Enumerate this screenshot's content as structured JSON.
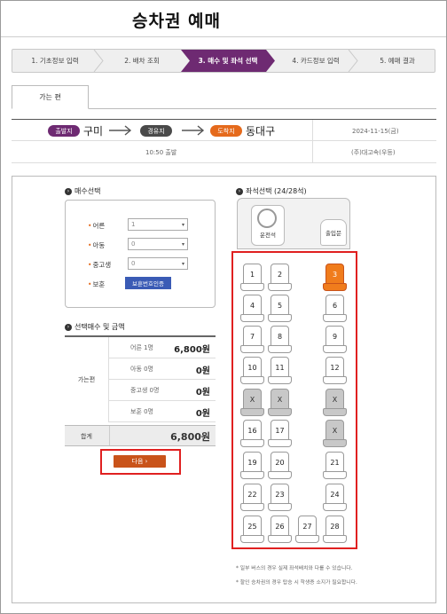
{
  "page": {
    "title": "승차권 예매"
  },
  "steps": [
    {
      "label": "1. 기초정보 입력"
    },
    {
      "label": "2. 배차 조회"
    },
    {
      "label": "3. 매수 및 좌석 선택"
    },
    {
      "label": "4. 카드정보 입력"
    },
    {
      "label": "5. 예매 결과"
    }
  ],
  "tab": {
    "label": "가는 편"
  },
  "route": {
    "dep_badge": "출발지",
    "dep_place": "구미",
    "via_badge": "경유지",
    "arr_badge": "도착지",
    "arr_place": "동대구",
    "date": "2024-11-15(금)",
    "dep_time": "10:50 출발",
    "company": "(주)대고속(우등)"
  },
  "count": {
    "heading": "매수선택",
    "rows": [
      {
        "label": "어른",
        "value": "1"
      },
      {
        "label": "아동",
        "value": "0"
      },
      {
        "label": "중고생",
        "value": "0"
      },
      {
        "label": "보훈",
        "button": "보훈번호인증"
      }
    ]
  },
  "price": {
    "heading": "선택매수 및 금액",
    "group_label": "가는편",
    "rows": [
      {
        "label": "어른 1명",
        "value": "6,800원"
      },
      {
        "label": "아동 0명",
        "value": "0원"
      },
      {
        "label": "중고생 0명",
        "value": "0원"
      },
      {
        "label": "보훈 0명",
        "value": "0원"
      }
    ],
    "total_label": "합계",
    "total_value": "6,800원"
  },
  "next_button": "다음",
  "seat": {
    "heading": "좌석선택 (24/28석)",
    "driver_label": "운전석",
    "door_label": "출입문",
    "seats": [
      {
        "n": "1",
        "state": "open"
      },
      {
        "n": "2",
        "state": "open"
      },
      {
        "n": "3",
        "state": "selected"
      },
      {
        "n": "4",
        "state": "open"
      },
      {
        "n": "5",
        "state": "open"
      },
      {
        "n": "6",
        "state": "open"
      },
      {
        "n": "7",
        "state": "open"
      },
      {
        "n": "8",
        "state": "open"
      },
      {
        "n": "9",
        "state": "open"
      },
      {
        "n": "10",
        "state": "open"
      },
      {
        "n": "11",
        "state": "open"
      },
      {
        "n": "12",
        "state": "open"
      },
      {
        "n": "X",
        "state": "taken"
      },
      {
        "n": "X",
        "state": "taken"
      },
      {
        "n": "X",
        "state": "taken"
      },
      {
        "n": "16",
        "state": "open"
      },
      {
        "n": "17",
        "state": "open"
      },
      {
        "n": "X",
        "state": "taken"
      },
      {
        "n": "19",
        "state": "open"
      },
      {
        "n": "20",
        "state": "open"
      },
      {
        "n": "21",
        "state": "open"
      },
      {
        "n": "22",
        "state": "open"
      },
      {
        "n": "23",
        "state": "open"
      },
      {
        "n": "24",
        "state": "open"
      },
      {
        "n": "25",
        "state": "open"
      },
      {
        "n": "26",
        "state": "open"
      },
      {
        "n": "27",
        "state": "open"
      },
      {
        "n": "28",
        "state": "open"
      }
    ],
    "notes": [
      "* 일부 버스의 경우 실제 좌석배치와 다를 수 있습니다.",
      "* 할인 승차권의 경우 탑승 시 학생증 소지가 필요합니다."
    ]
  }
}
